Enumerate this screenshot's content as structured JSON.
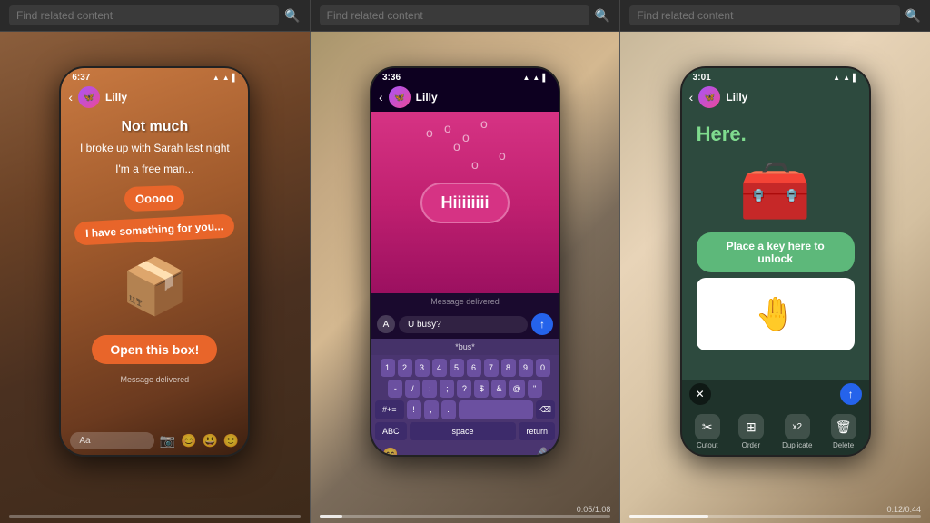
{
  "search_bars": [
    {
      "placeholder": "Find related content",
      "id": "search1"
    },
    {
      "placeholder": "Find related content",
      "id": "search2"
    },
    {
      "placeholder": "Find related content",
      "id": "search3"
    }
  ],
  "panel1": {
    "status_time": "6:37",
    "contact_name": "Lilly",
    "messages": [
      "Not much",
      "I broke up with Sarah last night",
      "I'm a free man..."
    ],
    "bubble1": "Ooooo",
    "bubble2": "I have something for you...",
    "cta": "Open this box!",
    "delivered": "Message delivered",
    "input_placeholder": "Aa"
  },
  "panel2": {
    "status_time": "3:36",
    "contact_name": "Lilly",
    "hiiiii": "Hiiiiiiii",
    "delivered": "Message delivered",
    "input_text": "U busy?",
    "prediction": "*bus*",
    "keyboard_rows": [
      [
        "1",
        "2",
        "3",
        "4",
        "5",
        "6",
        "7",
        "8",
        "9",
        "0"
      ],
      [
        "-",
        "/",
        ":",
        ";",
        "?",
        "$",
        "&",
        "@",
        "\""
      ],
      [
        "#+=",
        "!",
        ",",
        ".",
        " ",
        "⌫"
      ],
      [
        "ABC",
        "space",
        "return"
      ]
    ],
    "timeline_time": "0:05/1:08"
  },
  "panel3": {
    "status_time": "3:01",
    "contact_name": "Lilly",
    "here_text": "Here.",
    "unlock_text": "Place a key here to unlock",
    "actions": [
      {
        "label": "Cutout",
        "icon": "✂"
      },
      {
        "label": "Order",
        "icon": "⊞"
      },
      {
        "label": "Duplicate",
        "icon": "⧉"
      },
      {
        "label": "Delete",
        "icon": "🗑"
      }
    ],
    "timeline_time": "0:12/0:44"
  }
}
